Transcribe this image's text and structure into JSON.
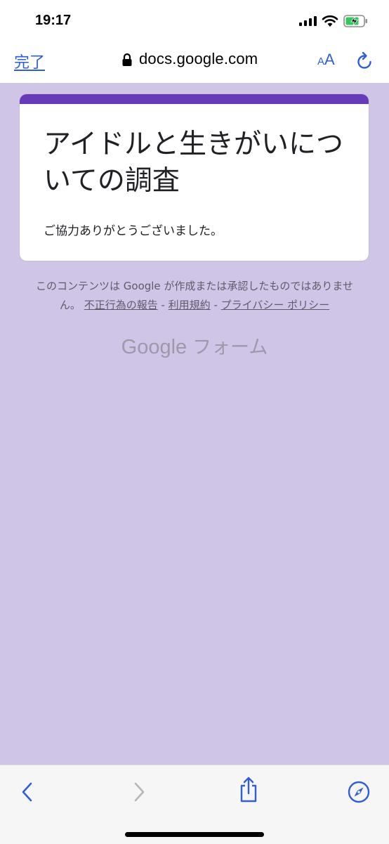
{
  "status_bar": {
    "time": "19:17"
  },
  "browser": {
    "done_label": "完了",
    "url": "docs.google.com",
    "text_size_small": "A",
    "text_size_large": "A"
  },
  "form": {
    "title": "アイドルと生きがいについての調査",
    "confirmation": "ご協力ありがとうございました。"
  },
  "footer": {
    "disclaimer": "このコンテンツは Google が作成または承認したものではありません。",
    "links": [
      "不正行為の報告",
      "利用規約",
      "プライバシー ポリシー"
    ],
    "separator": " - "
  },
  "brand": {
    "google": "Google",
    "product": "フォーム"
  },
  "colors": {
    "background": "#cfc6e7",
    "accent": "#673ab7",
    "link_blue": "#2f5ed8"
  },
  "icons": [
    "signal-icon",
    "wifi-icon",
    "battery-charging-icon",
    "lock-icon",
    "reload-icon",
    "back-icon",
    "forward-icon",
    "share-icon",
    "compass-icon"
  ]
}
